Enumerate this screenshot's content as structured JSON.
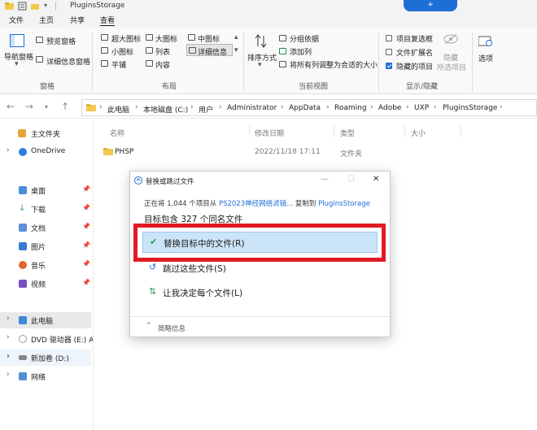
{
  "window": {
    "title": "PluginsStorage",
    "top_badge": "+"
  },
  "menu": {
    "tabs": [
      "文件",
      "主页",
      "共享",
      "查看"
    ],
    "active_tab": "查看"
  },
  "ribbon": {
    "nav_pane": "导航窗格",
    "preview_pane": "预览窗格",
    "details_pane": "详细信息窗格",
    "group_panes": "窗格",
    "layout": {
      "xl_icons": "超大图标",
      "l_icons": "大图标",
      "m_icons": "中图标",
      "s_icons": "小图标",
      "list": "列表",
      "details": "详细信息",
      "tiles": "平铺",
      "content": "内容"
    },
    "group_layout": "布局",
    "sort_by": "排序方式",
    "group_by": "分组依据",
    "add_columns": "添加列",
    "size_all_columns": "将所有列调整为合适的大小",
    "group_current_view": "当前视图",
    "item_checkboxes": "项目复选框",
    "file_extensions": "文件扩展名",
    "hidden_items": "隐藏的项目",
    "hidden_items_checked": true,
    "hide_selected": "隐藏",
    "hide_selected_sub": "所选项目",
    "group_show_hide": "显示/隐藏",
    "options": "选项"
  },
  "address": {
    "crumbs": [
      "此电脑",
      "本地磁盘 (C:)",
      "用户",
      "Administrator",
      "AppData",
      "Roaming",
      "Adobe",
      "UXP",
      "PluginsStorage"
    ]
  },
  "nav_pane": {
    "items": [
      {
        "label": "主文件夹",
        "icon": "home-icon"
      },
      {
        "label": "OneDrive",
        "icon": "cloud-icon"
      },
      {
        "label": "桌面",
        "icon": "desktop-icon"
      },
      {
        "label": "下载",
        "icon": "download-icon"
      },
      {
        "label": "文档",
        "icon": "document-icon"
      },
      {
        "label": "图片",
        "icon": "picture-icon"
      },
      {
        "label": "音乐",
        "icon": "music-icon"
      },
      {
        "label": "视频",
        "icon": "video-icon"
      },
      {
        "label": "此电脑",
        "icon": "computer-icon"
      },
      {
        "label": "DVD 驱动器 (E:) A",
        "icon": "dvd-icon"
      },
      {
        "label": "新加卷 (D:)",
        "icon": "drive-icon"
      },
      {
        "label": "网络",
        "icon": "network-icon"
      }
    ]
  },
  "file_list": {
    "headers": {
      "name": "名称",
      "modified": "修改日期",
      "type": "类型",
      "size": "大小"
    },
    "rows": [
      {
        "name": "PHSP",
        "modified": "2022/11/18 17:11",
        "type": "文件夹",
        "size": ""
      }
    ]
  },
  "dialog": {
    "title": "替换或跳过文件",
    "info_prefix": "正在将 1,044 个项目从 ",
    "info_source": "PS2023神经网络滤镜...",
    "info_middle": " 复制到 ",
    "info_dest": "PluginsStorage",
    "heading": "目标包含 327 个同名文件",
    "options": [
      {
        "label": "替换目标中的文件(R)",
        "icon": "check-icon"
      },
      {
        "label": "跳过这些文件(S)",
        "icon": "skip-icon"
      },
      {
        "label": "让我决定每个文件(L)",
        "icon": "decide-icon"
      }
    ],
    "details": "简略信息"
  },
  "colors": {
    "accent": "#1d6fd8",
    "highlight": "#e01b24",
    "selection": "#cce4f7"
  }
}
